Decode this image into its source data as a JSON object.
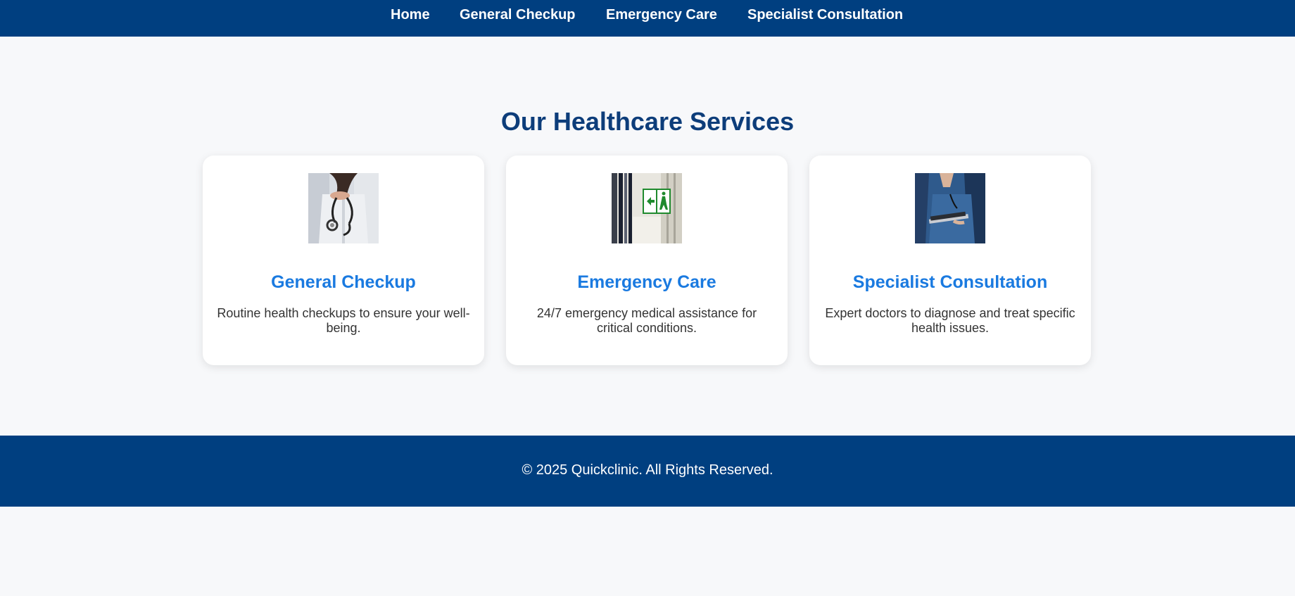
{
  "nav": {
    "items": [
      {
        "label": "Home"
      },
      {
        "label": "General Checkup"
      },
      {
        "label": "Emergency Care"
      },
      {
        "label": "Specialist Consultation"
      }
    ]
  },
  "services": {
    "title": "Our Healthcare Services",
    "cards": [
      {
        "title": "General Checkup",
        "description": "Routine health checkups to ensure your well-being.",
        "image": "doctor-stethoscope-photo"
      },
      {
        "title": "Emergency Care",
        "description": "24/7 emergency medical assistance for critical conditions.",
        "image": "emergency-exit-sign-photo"
      },
      {
        "title": "Specialist Consultation",
        "description": "Expert doctors to diagnose and treat specific health issues.",
        "image": "doctor-clipboard-photo"
      }
    ]
  },
  "footer": {
    "text": "© 2025 Quickclinic. All Rights Reserved."
  },
  "colors": {
    "nav_background": "#003f80",
    "title": "#0d3d7a",
    "card_title": "#1a7ae0",
    "page_background": "#f7f8fa"
  }
}
